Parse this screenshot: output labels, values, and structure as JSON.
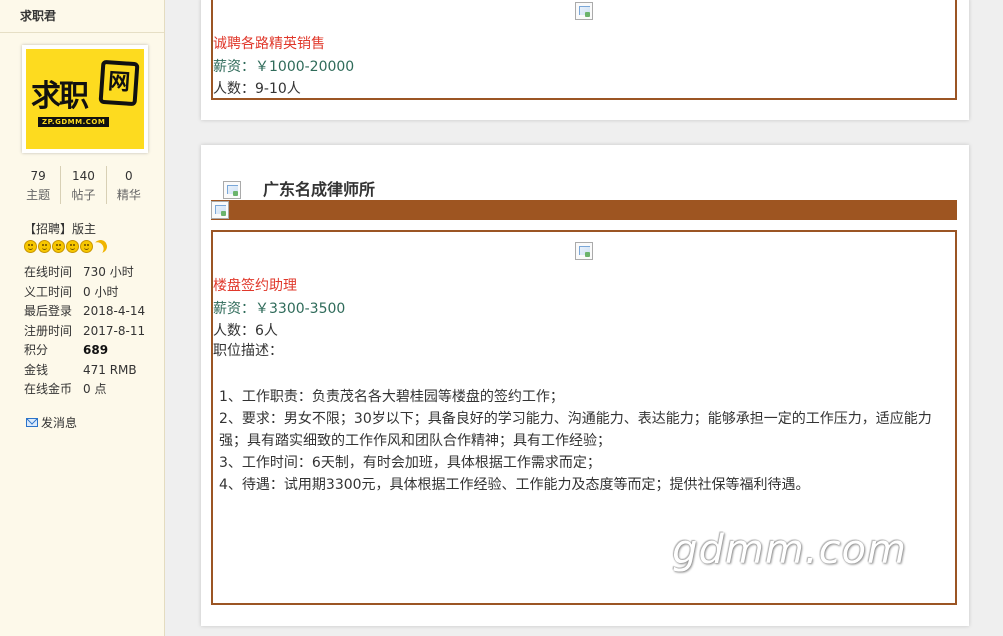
{
  "sidebar": {
    "username": "求职君",
    "avatar": {
      "logo_text": "求职",
      "logo_box_text": "网",
      "logo_domain": "ZP.GDMM.COM"
    },
    "stats": [
      {
        "num": "79",
        "label": "主题"
      },
      {
        "num": "140",
        "label": "帖子"
      },
      {
        "num": "0",
        "label": "精华"
      }
    ],
    "group": {
      "tag": "【招聘】",
      "role": "版主"
    },
    "info": [
      {
        "key": "在线时间",
        "value": "730 小时"
      },
      {
        "key": "义工时间",
        "value": "0 小时"
      },
      {
        "key": "最后登录",
        "value": "2018-4-14"
      },
      {
        "key": "注册时间",
        "value": "2017-8-11"
      },
      {
        "key": "积分",
        "value": "689"
      },
      {
        "key": "金钱",
        "value": "471 RMB"
      },
      {
        "key": "在线金币",
        "value": "0 点"
      }
    ],
    "send_message": "发消息"
  },
  "posts": [
    {
      "job": {
        "title": "诚聘各路精英销售",
        "salary": "薪资：￥1000-20000",
        "count": "人数：9-10人"
      }
    },
    {
      "company": "广东名成律师所",
      "job": {
        "title": "楼盘签约助理",
        "salary": "薪资：￥3300-3500",
        "count": "人数：6人",
        "desc_label": "职位描述：",
        "desc": [
          "1、工作职责：负责茂名各大碧桂园等楼盘的签约工作；",
          "2、要求：男女不限；30岁以下；具备良好的学习能力、沟通能力、表达能力；能够承担一定的工作压力，适应能力强；具有踏实细致的工作作风和团队合作精神；具有工作经验；",
          "3、工作时间：6天制，有时会加班，具体根据工作需求而定；",
          "4、待遇：试用期3300元，具体根据工作经验、工作能力及态度等而定；提供社保等福利待遇。"
        ]
      }
    }
  ],
  "watermark": "gdmm.com",
  "colors": {
    "accent_brown": "#9e5521",
    "job_title_red": "#e0382b",
    "salary_green": "#2f6b5a",
    "sidebar_bg": "#fdf9ea"
  }
}
